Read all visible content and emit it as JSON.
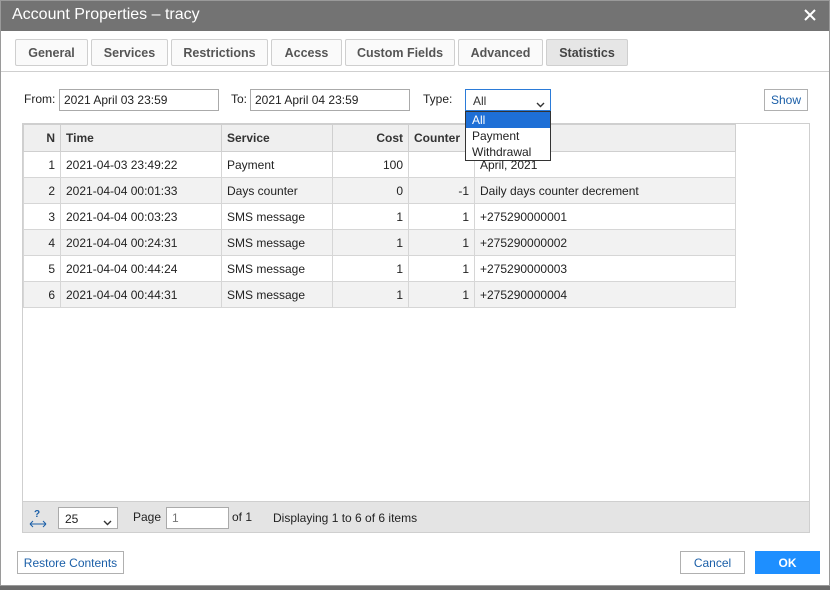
{
  "window": {
    "title": "Account Properties – tracy"
  },
  "tabs": [
    {
      "label": "General"
    },
    {
      "label": "Services"
    },
    {
      "label": "Restrictions"
    },
    {
      "label": "Access"
    },
    {
      "label": "Custom Fields"
    },
    {
      "label": "Advanced"
    },
    {
      "label": "Statistics",
      "active": true
    }
  ],
  "filter": {
    "from_label": "From:",
    "from_value": "2021 April 03 23:59",
    "to_label": "To:",
    "to_value": "2021 April 04 23:59",
    "type_label": "Type:",
    "type_value": "All",
    "type_options": [
      "All",
      "Payment",
      "Withdrawal"
    ],
    "show_label": "Show"
  },
  "grid": {
    "columns": [
      "N",
      "Time",
      "Service",
      "Cost",
      "Counter",
      ""
    ],
    "rows": [
      [
        "1",
        "2021-04-03 23:49:22",
        "Payment",
        "100",
        "",
        "April, 2021"
      ],
      [
        "2",
        "2021-04-04 00:01:33",
        "Days counter",
        "0",
        "-1",
        "Daily days counter decrement"
      ],
      [
        "3",
        "2021-04-04 00:03:23",
        "SMS message",
        "1",
        "1",
        "+275290000001"
      ],
      [
        "4",
        "2021-04-04 00:24:31",
        "SMS message",
        "1",
        "1",
        "+275290000002"
      ],
      [
        "5",
        "2021-04-04 00:44:24",
        "SMS message",
        "1",
        "1",
        "+275290000003"
      ],
      [
        "6",
        "2021-04-04 00:44:31",
        "SMS message",
        "1",
        "1",
        "+275290000004"
      ]
    ]
  },
  "pager": {
    "page_size": "25",
    "page_label": "Page",
    "page_placeholder": "1",
    "of_label": "of 1",
    "display_text": "Displaying 1 to 6 of 6 items"
  },
  "footer": {
    "restore_label": "Restore Contents",
    "cancel_label": "Cancel",
    "ok_label": "OK"
  },
  "colors": {
    "titlebar": "#737373",
    "accent": "#1e8fff",
    "link_text": "#1b5fa8"
  }
}
